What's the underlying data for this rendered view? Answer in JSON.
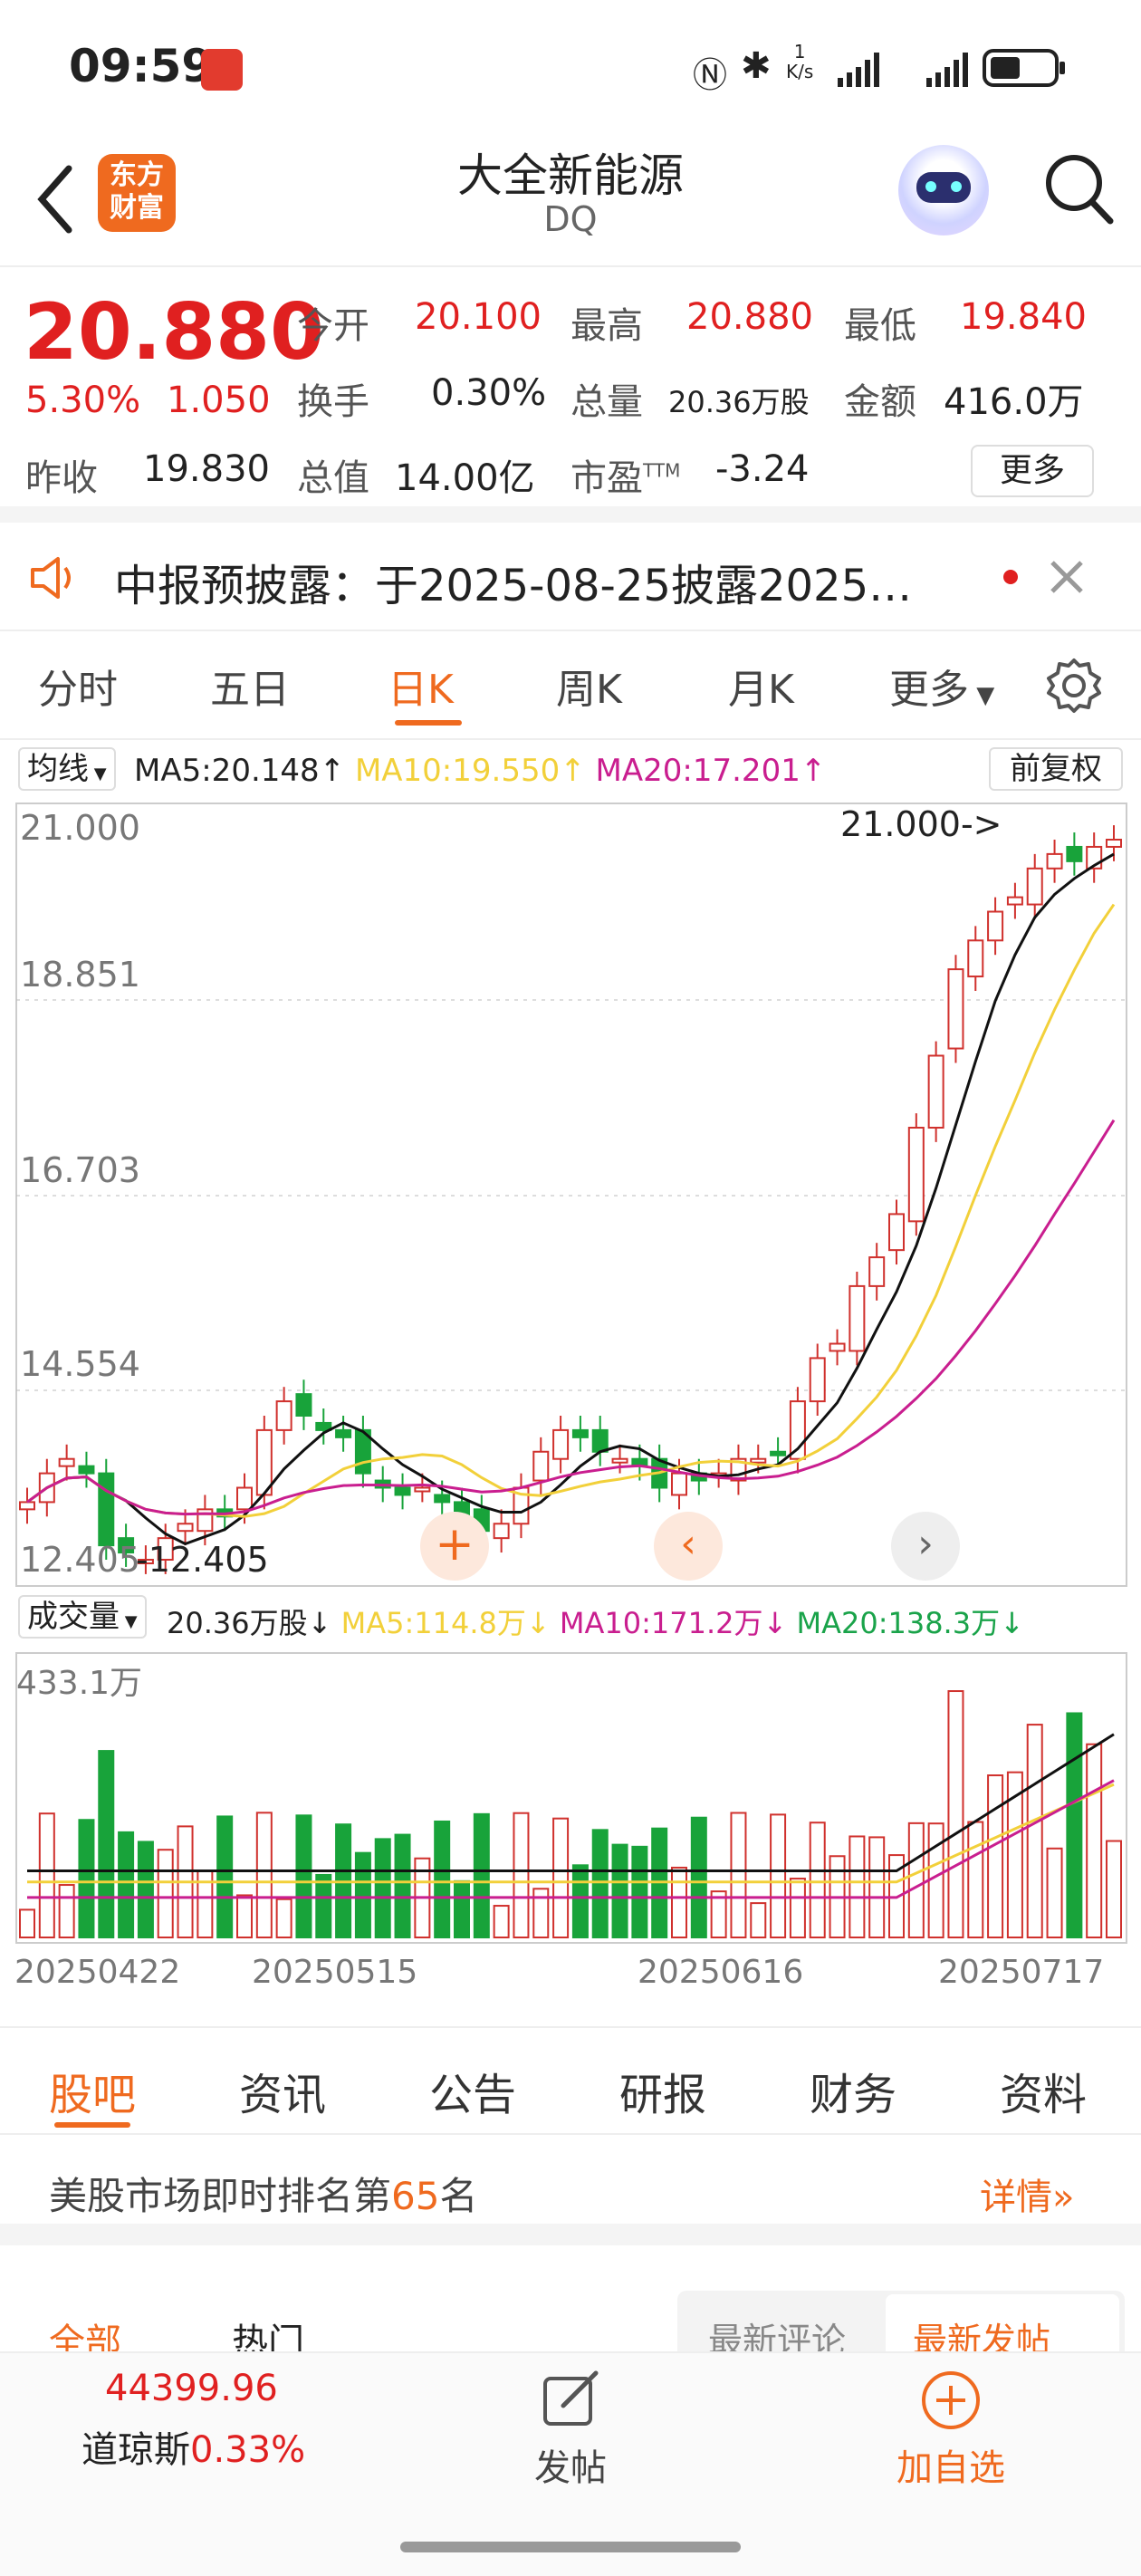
{
  "status_bar": {
    "time": "09:59",
    "net_speed_top": "1",
    "net_speed_unit": "K/s"
  },
  "header": {
    "logo_line1": "东方",
    "logo_line2": "财富",
    "title": "大全新能源",
    "ticker": "DQ"
  },
  "quote": {
    "price": "20.880",
    "change_pct": "5.30%",
    "change_abs": "1.050",
    "open_label": "今开",
    "open": "20.100",
    "high_label": "最高",
    "high": "20.880",
    "low_label": "最低",
    "low": "19.840",
    "turnover_label": "换手",
    "turnover": "0.30%",
    "volume_label": "总量",
    "volume": "20.36万股",
    "amount_label": "金额",
    "amount": "416.0万",
    "prev_close_label": "昨收",
    "prev_close": "19.830",
    "mktcap_label": "总值",
    "mktcap": "14.00亿",
    "pe_label": "市盈",
    "pe_sup": "TTM",
    "pe": "-3.24",
    "more_label": "更多"
  },
  "notice": {
    "text": "中报预披露：于2025-08-25披露2025…"
  },
  "periods": {
    "items": [
      "分时",
      "五日",
      "日K",
      "周K",
      "月K",
      "更多"
    ],
    "active": "日K"
  },
  "kline": {
    "indicator": "均线",
    "ma5": "MA5:20.148↑",
    "ma10": "MA10:19.550↑",
    "ma20": "MA20:17.201↑",
    "adjust": "前复权",
    "y_labels": [
      "21.000",
      "18.851",
      "16.703",
      "14.554",
      "12.405"
    ],
    "max_note": "21.000->",
    "min_note": "12.405",
    "colors": {
      "up": "#d0312d",
      "down": "#18a33a",
      "ma5": "#111111",
      "ma10": "#f2d03a",
      "ma20": "#c91e8f"
    }
  },
  "volume": {
    "indicator": "成交量",
    "value": "20.36万股↓",
    "ma5": "MA5:114.8万↓",
    "ma10": "MA10:171.2万↓",
    "ma20": "MA20:138.3万↓",
    "max": "433.1万",
    "dates": [
      "20250422",
      "20250515",
      "20250616",
      "20250717"
    ]
  },
  "sub_tabs": {
    "items": [
      "股吧",
      "资讯",
      "公告",
      "研报",
      "财务",
      "资料"
    ],
    "active": "股吧"
  },
  "rank": {
    "prefix": "美股市场即时排名第",
    "rank": "65",
    "suffix": "名",
    "detail": "详情"
  },
  "feed_tabs": {
    "left": [
      "全部",
      "热门"
    ],
    "right": [
      "最新评论",
      "最新发帖"
    ]
  },
  "bottom": {
    "index_value": "44399.96",
    "index_name": "道琼斯",
    "index_change": "0.33%",
    "post": "发帖",
    "add": "加自选"
  }
}
